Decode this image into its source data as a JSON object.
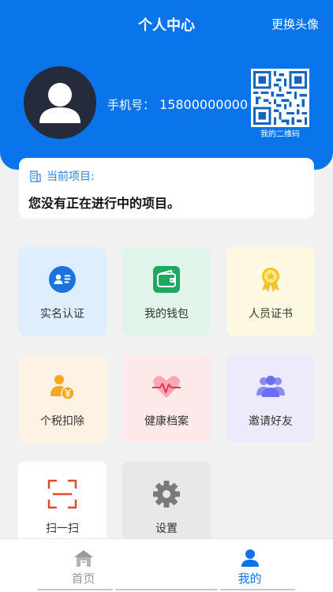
{
  "header": {
    "title": "个人中心",
    "change_avatar": "更换头像",
    "phone_label": "手机号：",
    "phone_number": "15800000000",
    "qr_label": "我的二维码"
  },
  "project": {
    "heading": "当前项目:",
    "message": "您没有正在进行中的项目。"
  },
  "menu": {
    "items": [
      {
        "label": "实名认证",
        "icon": "id-card-icon"
      },
      {
        "label": "我的钱包",
        "icon": "wallet-icon"
      },
      {
        "label": "人员证书",
        "icon": "award-icon"
      },
      {
        "label": "个税扣除",
        "icon": "tax-icon"
      },
      {
        "label": "健康档案",
        "icon": "heartbeat-icon"
      },
      {
        "label": "邀请好友",
        "icon": "friends-icon"
      },
      {
        "label": "扫一扫",
        "icon": "scan-icon"
      },
      {
        "label": "设置",
        "icon": "gear-icon"
      }
    ]
  },
  "tabbar": {
    "home": "首页",
    "mine": "我的",
    "active": "mine"
  },
  "colors": {
    "brand": "#0a74ea",
    "inactive": "#999999"
  }
}
